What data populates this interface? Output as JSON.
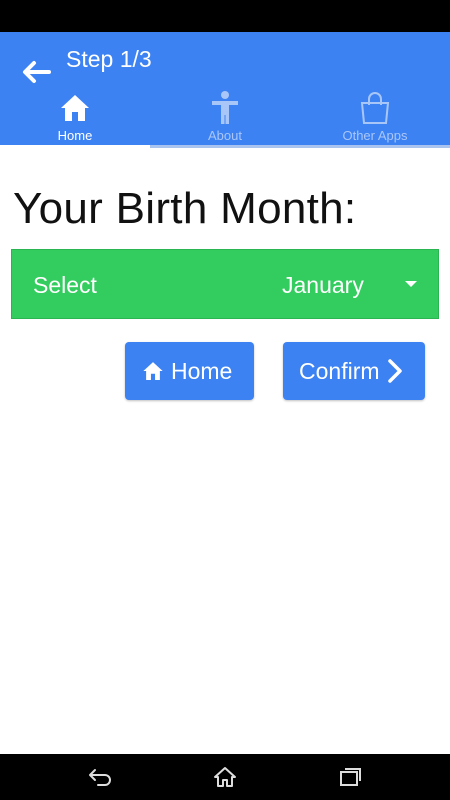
{
  "header": {
    "title": "Step 1/3",
    "back_icon": "arrow-left-icon"
  },
  "tabs": [
    {
      "label": "Home",
      "icon": "home-icon",
      "active": true
    },
    {
      "label": "About",
      "icon": "person-icon",
      "active": false
    },
    {
      "label": "Other Apps",
      "icon": "shopping-bag-icon",
      "active": false
    }
  ],
  "main": {
    "title": "Your Birth Month:",
    "select": {
      "label": "Select",
      "value": "January"
    },
    "buttons": {
      "home_label": "Home",
      "confirm_label": "Confirm"
    }
  },
  "colors": {
    "primary": "#3d82f3",
    "select_bg": "#33cd5f",
    "tab_inactive": "#a9c6f8"
  },
  "system_nav": {
    "icons": [
      "back-icon",
      "home-icon",
      "recents-icon"
    ]
  }
}
